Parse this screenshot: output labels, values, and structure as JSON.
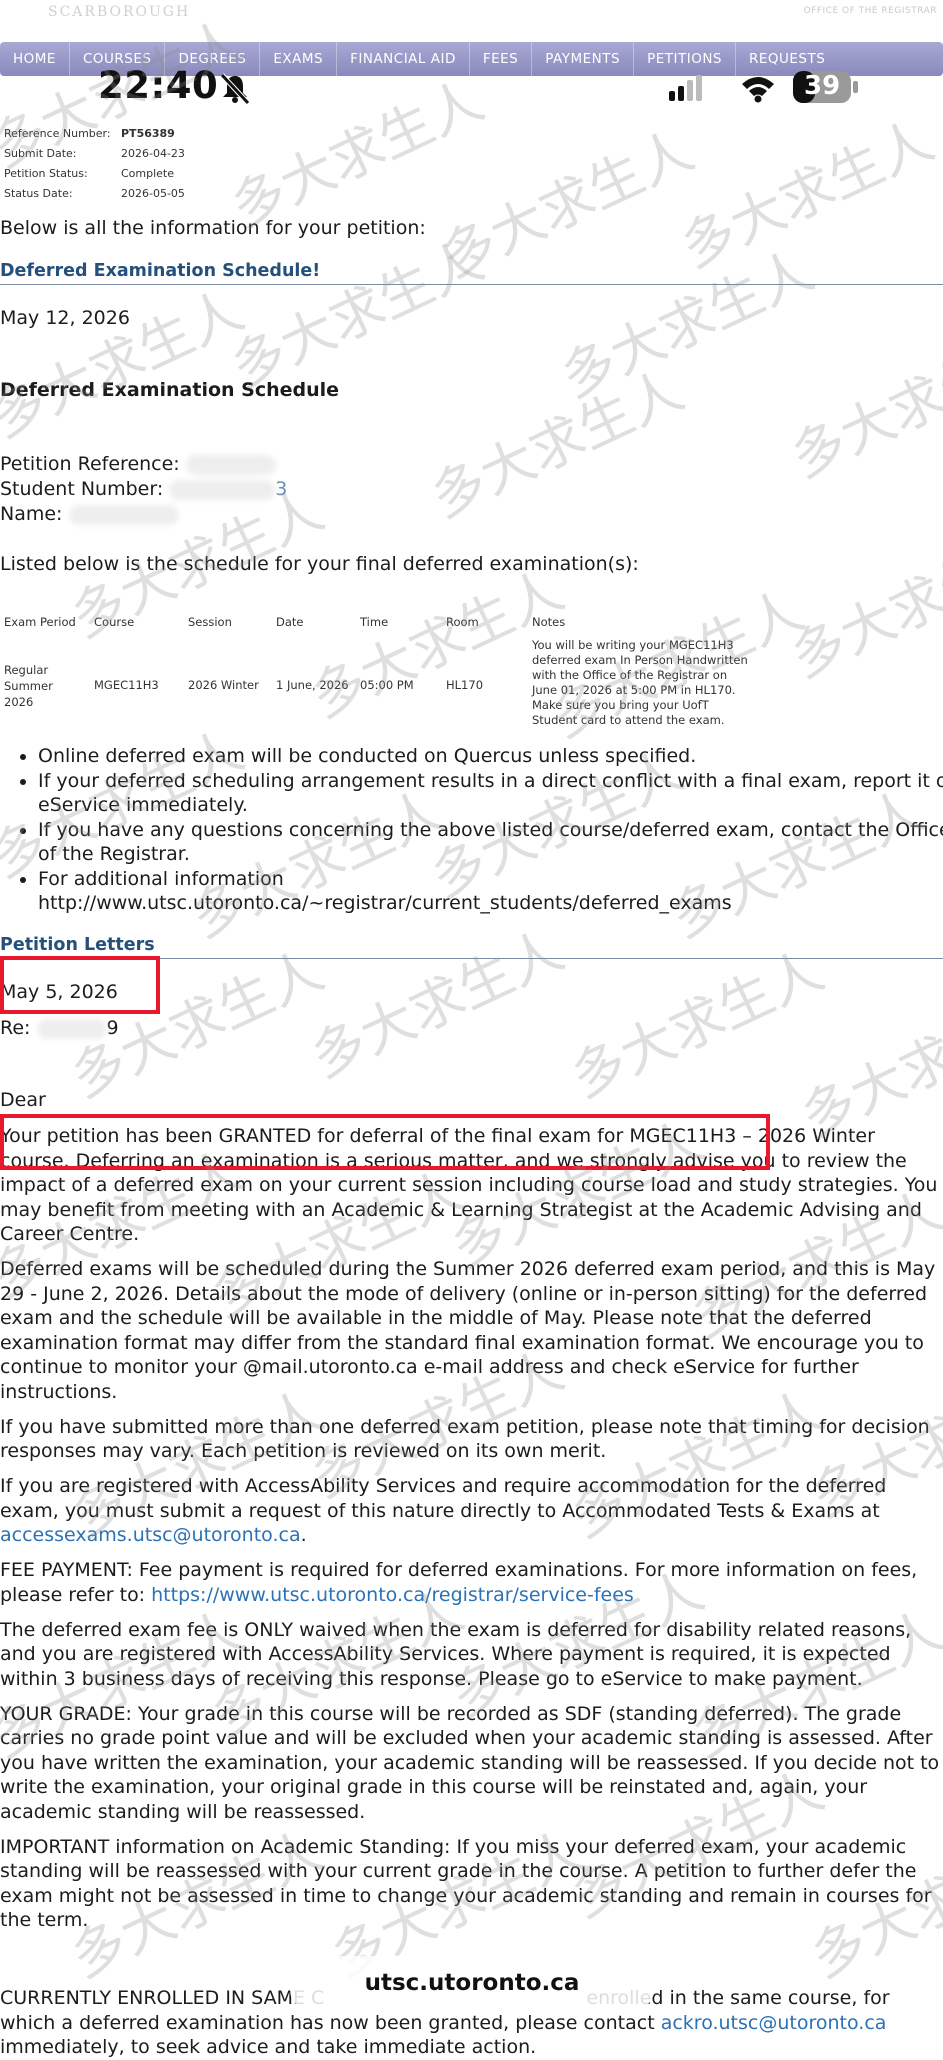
{
  "header": {
    "logo_text": "SCARBOROUGH",
    "office_text": "OFFICE OF THE REGISTRAR",
    "nav": [
      "HOME",
      "COURSES",
      "DEGREES",
      "EXAMS",
      "FINANCIAL AID",
      "FEES",
      "PAYMENTS",
      "PETITIONS",
      "REQUESTS"
    ]
  },
  "status_bar": {
    "time": "22:40",
    "battery": "39"
  },
  "petition_info": {
    "rows": [
      {
        "label": "Reference Number:",
        "value": "PT56389"
      },
      {
        "label": "Submit Date:",
        "value": "2026-04-23"
      },
      {
        "label": "Petition Status:",
        "value": "Complete"
      },
      {
        "label": "Status Date:",
        "value": "2026-05-05"
      }
    ]
  },
  "intro": "Below is all the information for your petition:",
  "deferred_section": {
    "title": "Deferred Examination Schedule!",
    "date": "May 12, 2026",
    "heading": "Deferred Examination Schedule",
    "petition_reference_label": "Petition Reference:",
    "student_number_label": "Student Number:",
    "student_number_visible": "3",
    "name_label": "Name:",
    "listed_text": "Listed below is the schedule for your final deferred examination(s):",
    "table": {
      "headers": [
        "Exam Period",
        "Course",
        "Session",
        "Date",
        "Time",
        "Room",
        "Notes"
      ],
      "row": {
        "exam_period": "Regular Summer 2026",
        "course": "MGEC11H3",
        "session": "2026 Winter",
        "date": "1 June, 2026",
        "time": "05:00 PM",
        "room": "HL170",
        "notes": "You will be writing your MGEC11H3 deferred exam In Person Handwritten with the Office of the Registrar on June 01, 2026 at 5:00 PM in HL170. Make sure you bring your UofT Student card to attend the exam."
      }
    },
    "bullets": [
      "Online deferred exam will be conducted on Quercus unless specified.",
      "If your deferred scheduling arrangement results in a direct conflict with a final exam, report it on eService immediately.",
      "If you have any questions concerning the above listed course/deferred exam, contact the Office of the Registrar.",
      "For additional information http://www.utsc.utoronto.ca/~registrar/current_students/deferred_exams"
    ]
  },
  "letters_section": {
    "title": "Petition Letters",
    "date": "May 5, 2026",
    "re_label": "Re:",
    "re_visible": "9",
    "dear": "Dear",
    "p1": "Your petition has been GRANTED for deferral of the final exam for MGEC11H3 – 2026 Winter course. Deferring an examination is a serious matter, and we strongly advise you to review the impact of a deferred exam on your current session including course load and study strategies. You may benefit from meeting with an Academic & Learning Strategist at the Academic Advising and Career Centre.",
    "p2": "Deferred exams will be scheduled during the Summer 2026 deferred exam period, and this is May 29 - June 2, 2026. Details about the mode of delivery (online or in-person sitting) for the deferred exam and the schedule will be available in the middle of May.  Please note that the deferred examination format may differ from the standard final examination format. We encourage you to continue to monitor your @mail.utoronto.ca e-mail address and check eService for further instructions.",
    "p3": "If you have submitted more than one deferred exam petition, please note that timing for decision responses may vary. Each petition is reviewed on its own merit.",
    "p4_text": "If you are registered with AccessAbility Services and require accommodation for the deferred exam, you must submit a request of this nature directly to Accommodated Tests & Exams at",
    "p4_link": "accessexams.utsc@utoronto.ca",
    "p5_text": "FEE PAYMENT: Fee payment is required for deferred examinations. For more information on fees, please refer to:",
    "p5_link": "https://www.utsc.utoronto.ca/registrar/service-fees",
    "p6": "The deferred exam fee is ONLY waived when the exam is deferred for disability related reasons, and you are registered with AccessAbility Services. Where payment is required, it is expected within 3 business days of receiving this response. Please go to eService to make payment.",
    "p7": "YOUR GRADE: Your grade in this course will be recorded as SDF (standing deferred). The grade carries no grade point value and will be excluded when your academic standing is assessed. After you have written the examination, your academic standing will be reassessed. If you decide not to write the examination, your original grade in this course will be reinstated and, again, your academic standing will be reassessed.",
    "p8": "IMPORTANT information on Academic Standing: If you miss your deferred exam, your academic standing will be reassessed with your current grade in the course.  A petition to further defer the exam might not be assessed in time to change your academic standing and remain in courses for the term.",
    "p9_a": "CURRENTLY ENROLLED IN SAME C",
    "p9_b": "enrolled in the same course, for which a deferred examination has now been granted, please",
    "p9_c": "contact",
    "p9_link": "ackro.utsc@utoronto.ca",
    "p9_d": "immediately, to seek advice and take immediate action."
  },
  "url_bar": {
    "domain": "utsc.utoronto.ca"
  },
  "watermark_text": "多大求生人"
}
